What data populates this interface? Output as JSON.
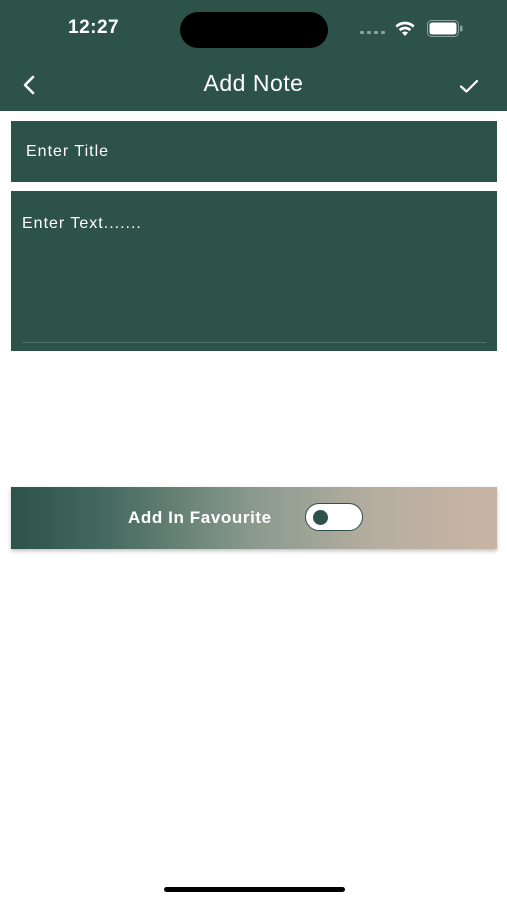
{
  "status_bar": {
    "time": "12:27"
  },
  "header": {
    "title": "Add Note",
    "back_icon": "chevron-left-icon",
    "save_icon": "checkmark-icon",
    "background_color": "#2c5249"
  },
  "form": {
    "title_placeholder": "Enter Title",
    "title_value": "",
    "text_placeholder": "Enter Text.......",
    "text_value": ""
  },
  "favourite": {
    "label": "Add In Favourite",
    "enabled": false
  },
  "colors": {
    "primary": "#2c5249",
    "gradient_end": "#c9b4a4"
  }
}
